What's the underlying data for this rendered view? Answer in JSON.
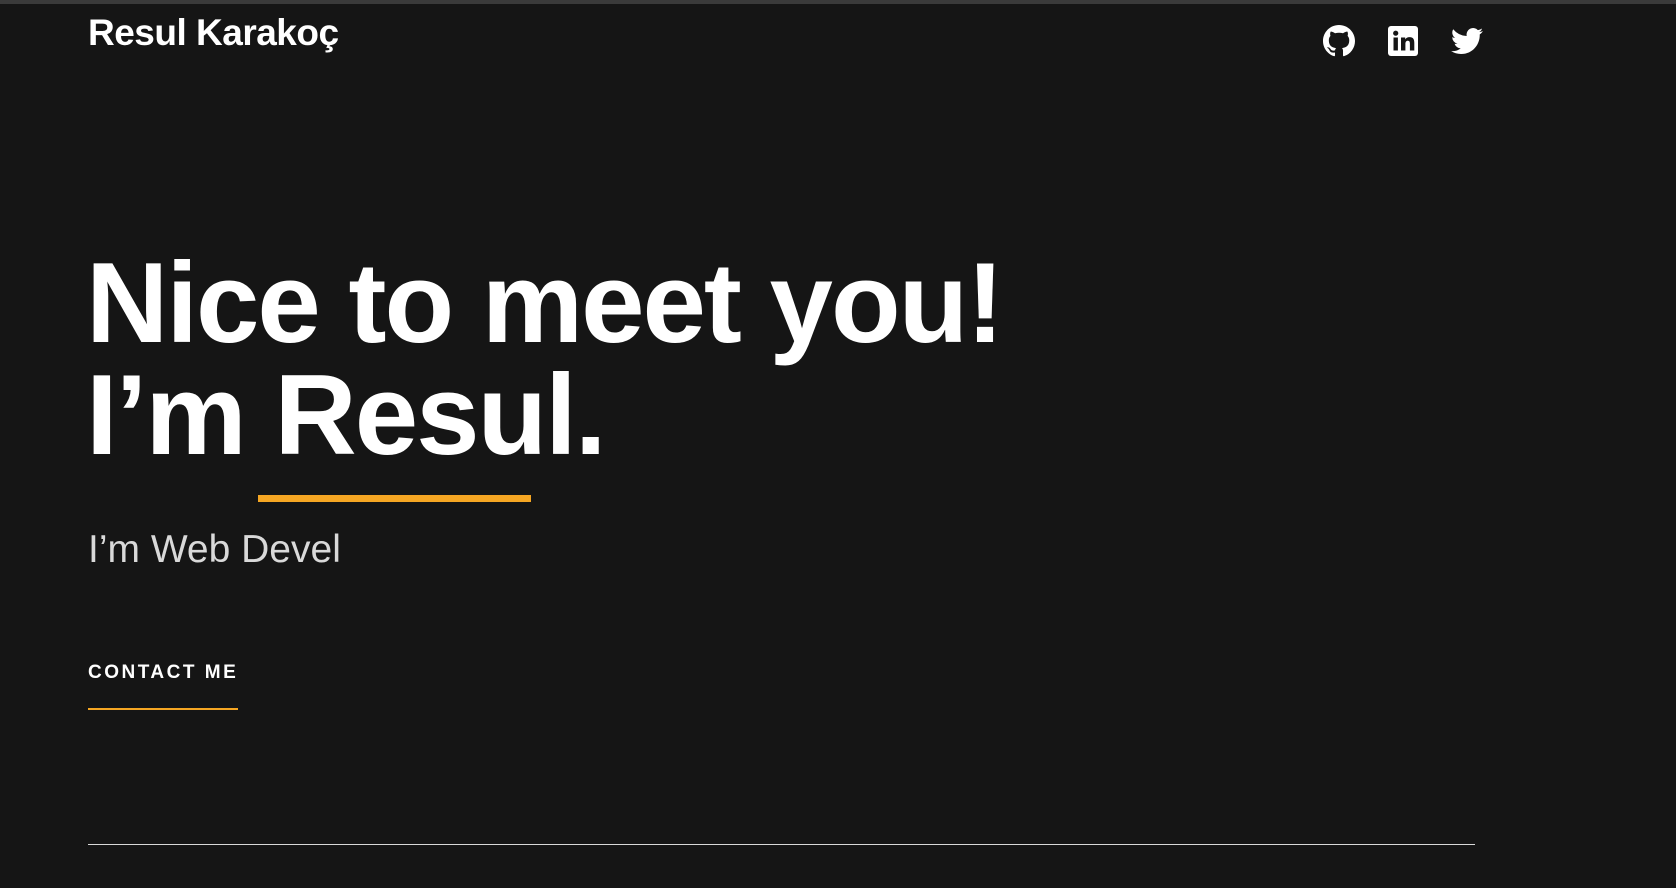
{
  "header": {
    "brand": "Resul Karakoç",
    "socials": [
      {
        "name": "GitHub",
        "icon": "github-icon"
      },
      {
        "name": "LinkedIn",
        "icon": "linkedin-icon"
      },
      {
        "name": "Twitter",
        "icon": "twitter-icon"
      }
    ]
  },
  "hero": {
    "line1": "Nice to meet you!",
    "line2_prefix": "I’m ",
    "name": "Resul",
    "line2_suffix": ".",
    "subtitle": "I’m Web Devel",
    "cta_label": "CONTACT ME"
  },
  "colors": {
    "background": "#151515",
    "accent": "#f5a623",
    "text": "#ffffff"
  }
}
